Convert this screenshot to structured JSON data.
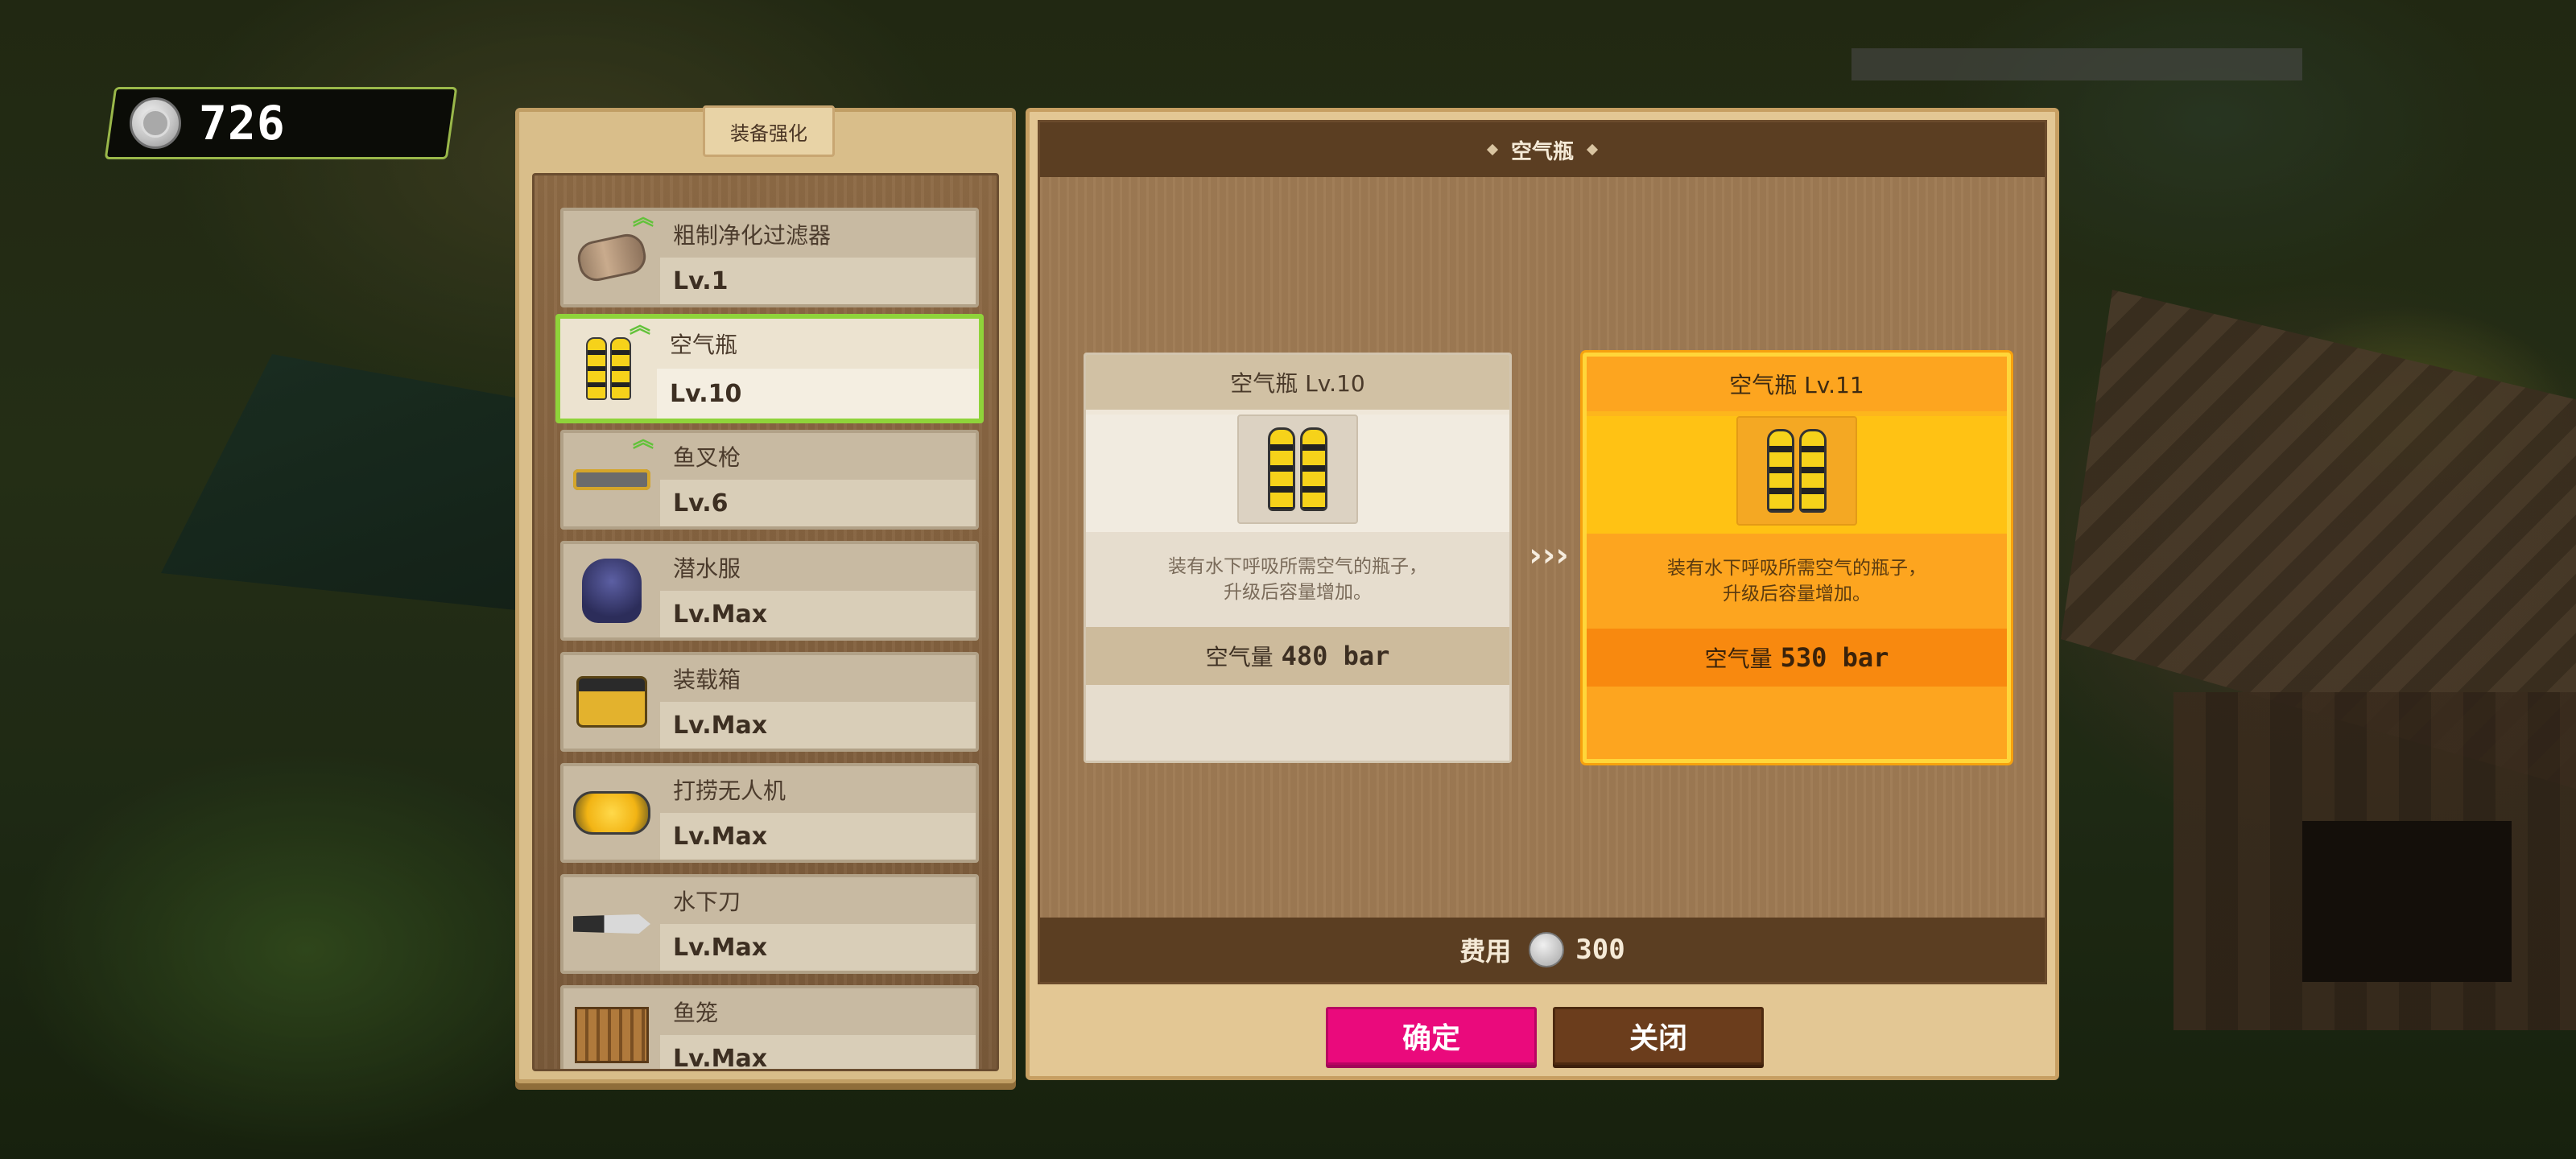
{
  "currency": {
    "icon": "silver-coin-icon",
    "amount": "726"
  },
  "list_panel": {
    "title": "装备强化",
    "items": [
      {
        "name": "粗制净化过滤器",
        "level": "Lv.1",
        "icon": "filter-icon",
        "upgradable": true
      },
      {
        "name": "空气瓶",
        "level": "Lv.10",
        "icon": "air-tank-icon",
        "upgradable": true,
        "selected": true
      },
      {
        "name": "鱼叉枪",
        "level": "Lv.6",
        "icon": "harpoon-gun-icon",
        "upgradable": true
      },
      {
        "name": "潜水服",
        "level": "Lv.Max",
        "icon": "diving-suit-icon",
        "upgradable": false
      },
      {
        "name": "装载箱",
        "level": "Lv.Max",
        "icon": "cargo-box-icon",
        "upgradable": false
      },
      {
        "name": "打捞无人机",
        "level": "Lv.Max",
        "icon": "salvage-drone-icon",
        "upgradable": false
      },
      {
        "name": "水下刀",
        "level": "Lv.Max",
        "icon": "underwater-knife-icon",
        "upgradable": false
      },
      {
        "name": "鱼笼",
        "level": "Lv.Max",
        "icon": "fish-trap-icon",
        "upgradable": false
      }
    ]
  },
  "detail": {
    "title": "空气瓶",
    "current": {
      "title": "空气瓶 Lv.10",
      "desc_line1": "装有水下呼吸所需空气的瓶子，",
      "desc_line2": "升级后容量增加。",
      "stat_label": "空气量",
      "stat_value": "480 bar"
    },
    "next": {
      "title": "空气瓶 Lv.11",
      "desc_line1": "装有水下呼吸所需空气的瓶子，",
      "desc_line2": "升级后容量增加。",
      "stat_label": "空气量",
      "stat_value": "530 bar"
    },
    "arrow": "›››",
    "cost_label": "费用",
    "cost_value": "300"
  },
  "buttons": {
    "confirm": "确定",
    "close": "关闭"
  },
  "colors": {
    "accent_confirm": "#ea0a7c",
    "highlight_selected": "#8fd33a",
    "next_card": "#fdb61c",
    "close_button": "#6b3d1c"
  }
}
